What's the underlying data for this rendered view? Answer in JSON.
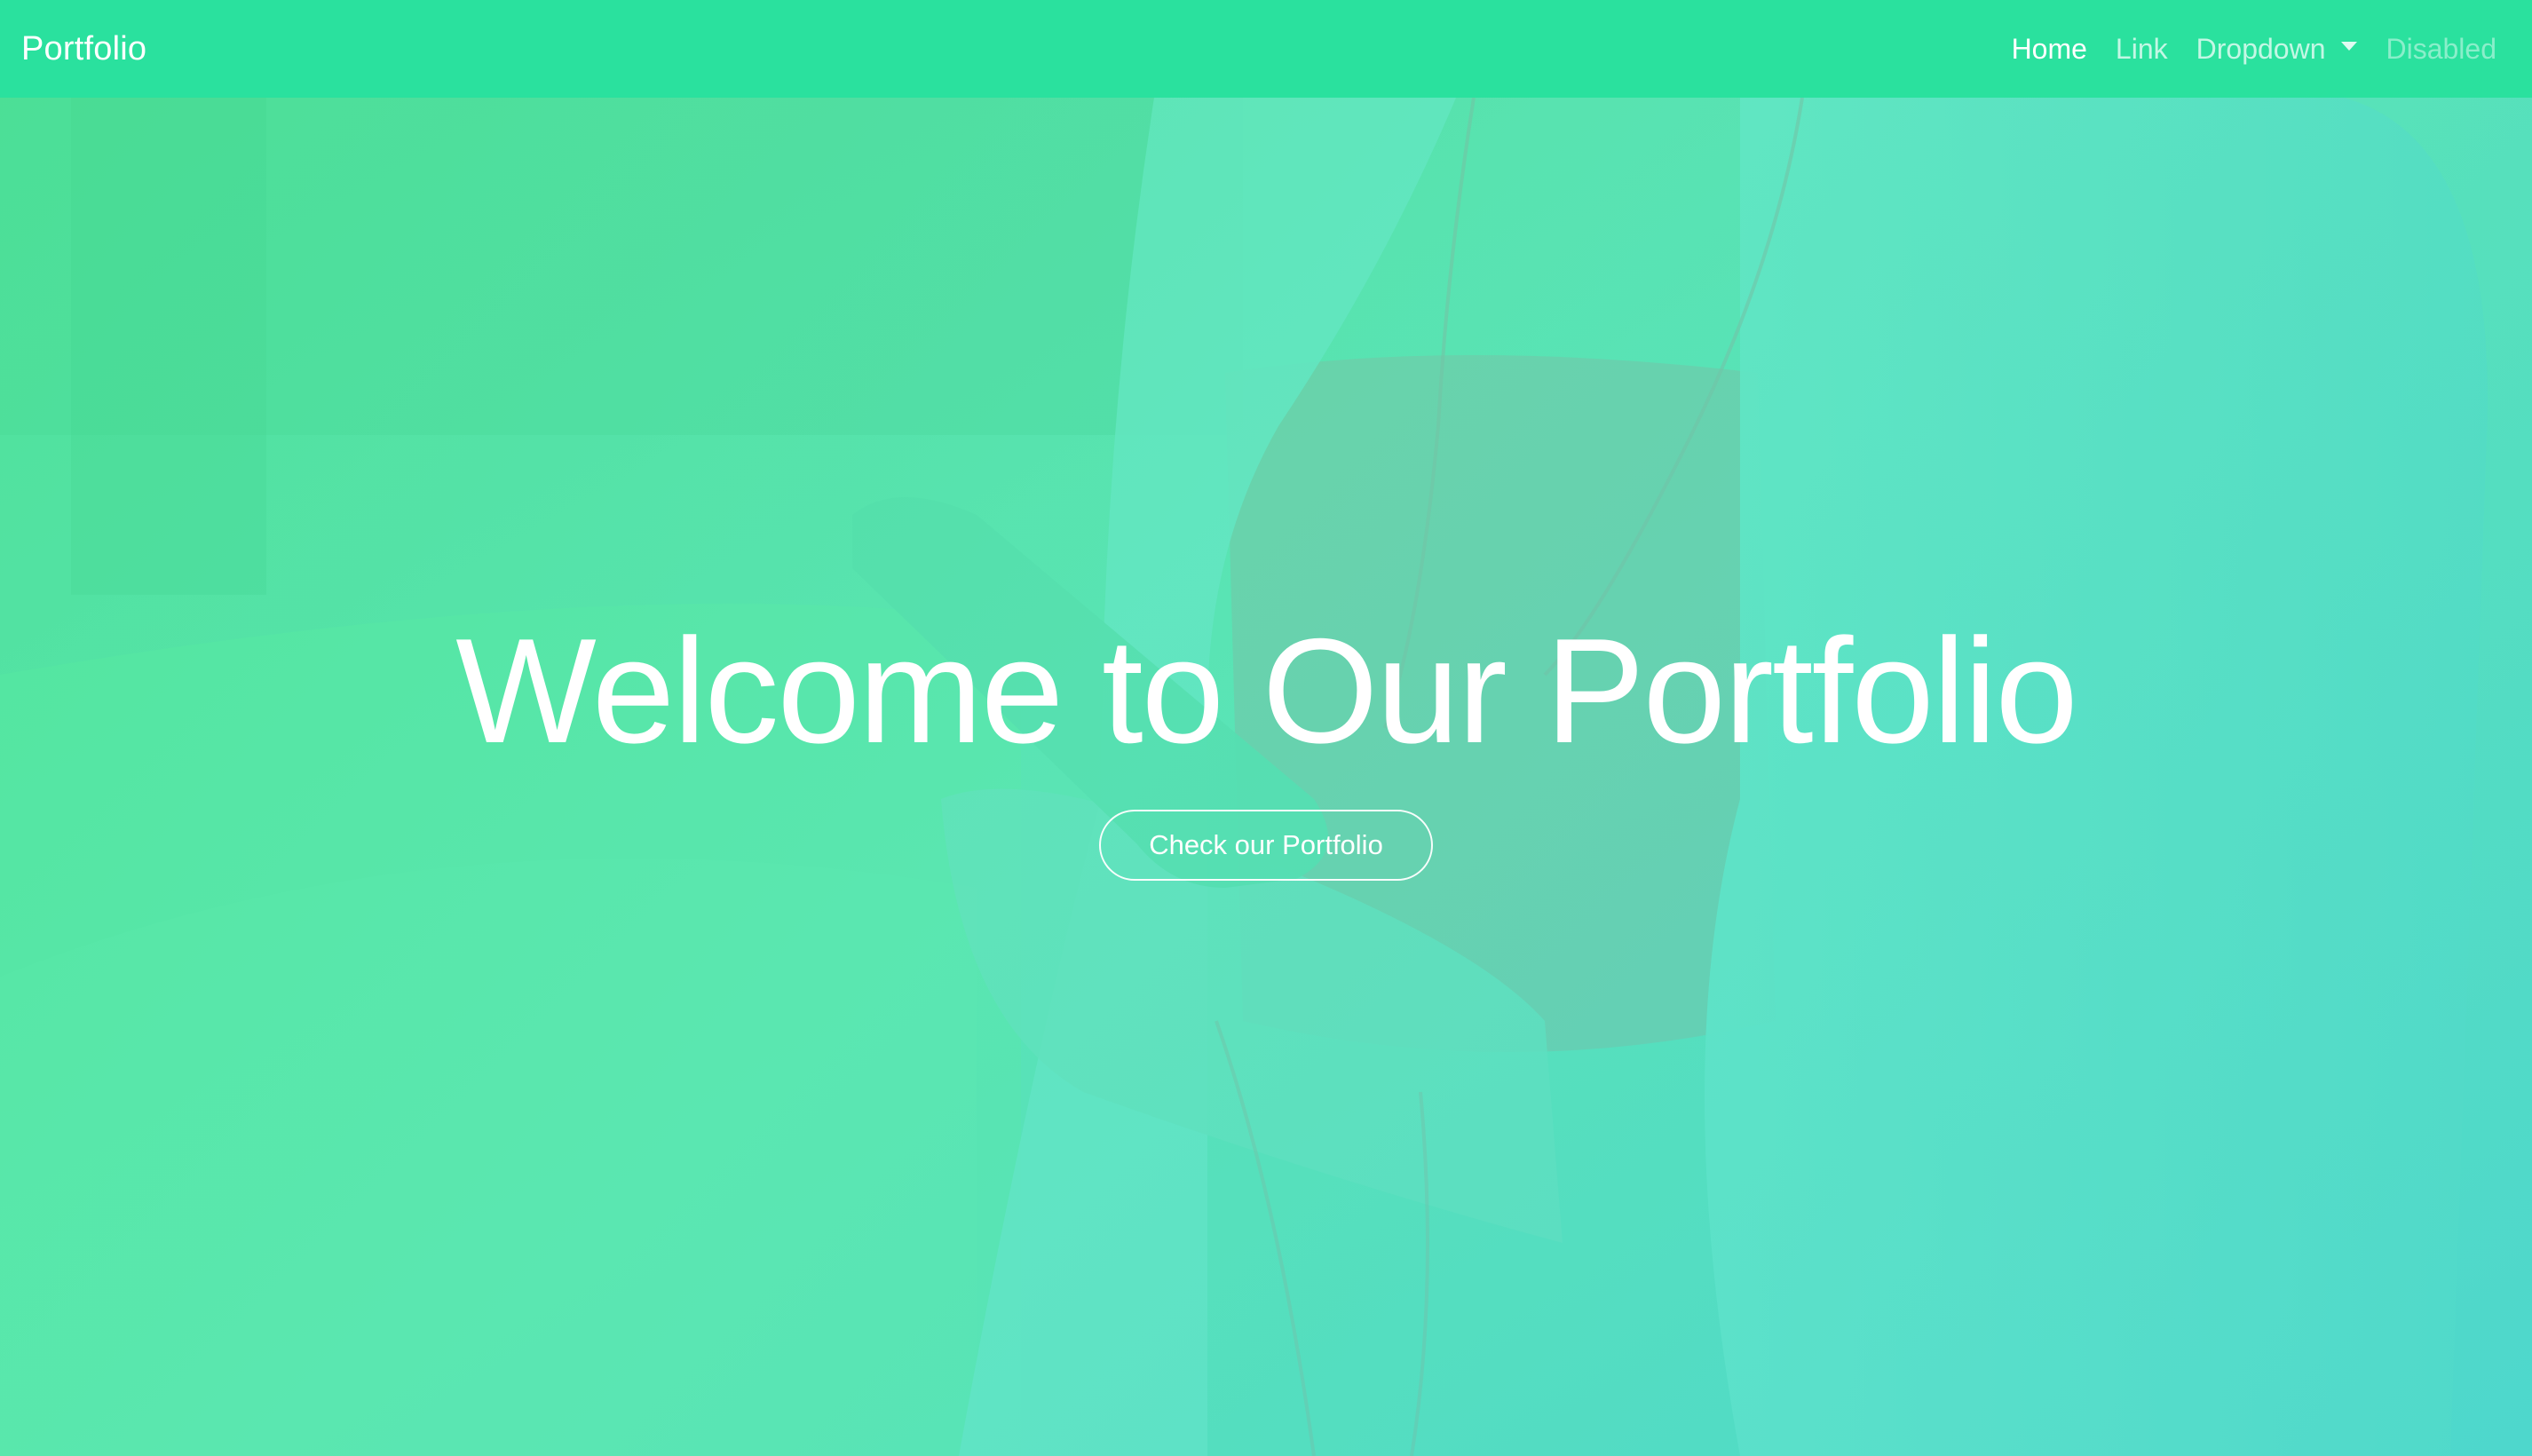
{
  "navbar": {
    "brand": "Portfolio",
    "links": [
      {
        "label": "Home",
        "state": "active"
      },
      {
        "label": "Link",
        "state": "normal"
      },
      {
        "label": "Dropdown",
        "state": "dropdown"
      },
      {
        "label": "Disabled",
        "state": "disabled"
      }
    ],
    "dropdown_icon": "caret-down-icon"
  },
  "hero": {
    "title": "Welcome to Our Portfolio",
    "button_label": "Check our Portfolio"
  },
  "colors": {
    "navbar_bg": "#2ae19e",
    "overlay_left": "#46e88c",
    "overlay_right": "#46d6cd",
    "text": "#ffffff"
  }
}
